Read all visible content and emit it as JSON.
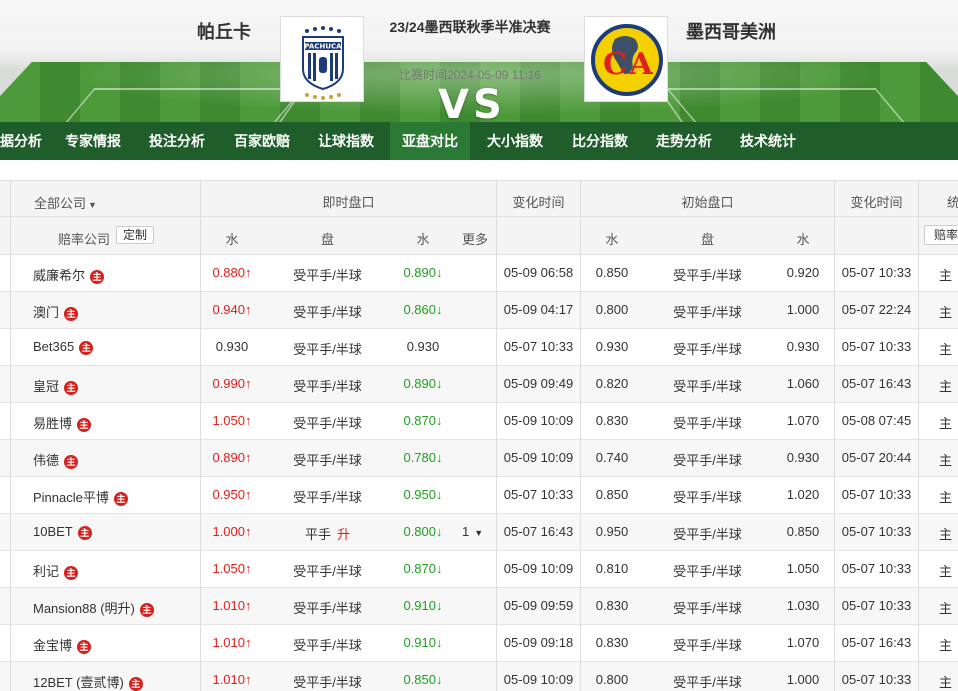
{
  "match": {
    "home_team": "帕丘卡",
    "away_team": "墨西哥美洲",
    "title": "23/24墨西联秋季半准决赛",
    "time": "比赛时间2024-05-09 11:16",
    "vs": "VS"
  },
  "nav": {
    "items": [
      "据分析",
      "专家情报",
      "投注分析",
      "百家欧赔",
      "让球指数",
      "亚盘对比",
      "大小指数",
      "比分指数",
      "走势分析",
      "技术统计"
    ],
    "active": "亚盘对比"
  },
  "table": {
    "header": {
      "all_companies": "全部公司",
      "live_group": "即时盘口",
      "change_time": "变化时间",
      "initial_group": "初始盘口",
      "change_time2": "变化时间",
      "stats_group": "统",
      "company_col": "赔率公司",
      "custom_btn": "定制",
      "water": "水",
      "handicap": "盘",
      "water2": "水",
      "more": "更多",
      "init_water": "水",
      "init_handicap": "盘",
      "init_water2": "水",
      "odds_btn": "赔率"
    },
    "badge": "主",
    "rows": [
      {
        "company": "威廉希尔",
        "live_home": "0.880",
        "live_home_dir": "up",
        "live_line": "受平手/半球",
        "live_line_change": "",
        "live_away": "0.890",
        "live_away_dir": "down",
        "more": "",
        "change_time": "05-09 06:58",
        "init_home": "0.850",
        "init_line": "受平手/半球",
        "init_away": "0.920",
        "init_time": "05-07 10:33",
        "tail": "主"
      },
      {
        "company": "澳门",
        "live_home": "0.940",
        "live_home_dir": "up",
        "live_line": "受平手/半球",
        "live_line_change": "",
        "live_away": "0.860",
        "live_away_dir": "down",
        "more": "",
        "change_time": "05-09 04:17",
        "init_home": "0.800",
        "init_line": "受平手/半球",
        "init_away": "1.000",
        "init_time": "05-07 22:24",
        "tail": "主"
      },
      {
        "company": "Bet365",
        "live_home": "0.930",
        "live_home_dir": "",
        "live_line": "受平手/半球",
        "live_line_change": "",
        "live_away": "0.930",
        "live_away_dir": "",
        "more": "",
        "change_time": "05-07 10:33",
        "init_home": "0.930",
        "init_line": "受平手/半球",
        "init_away": "0.930",
        "init_time": "05-07 10:33",
        "tail": "主"
      },
      {
        "company": "皇冠",
        "live_home": "0.990",
        "live_home_dir": "up",
        "live_line": "受平手/半球",
        "live_line_change": "",
        "live_away": "0.890",
        "live_away_dir": "down",
        "more": "",
        "change_time": "05-09 09:49",
        "init_home": "0.820",
        "init_line": "受平手/半球",
        "init_away": "1.060",
        "init_time": "05-07 16:43",
        "tail": "主"
      },
      {
        "company": "易胜博",
        "live_home": "1.050",
        "live_home_dir": "up",
        "live_line": "受平手/半球",
        "live_line_change": "",
        "live_away": "0.870",
        "live_away_dir": "down",
        "more": "",
        "change_time": "05-09 10:09",
        "init_home": "0.830",
        "init_line": "受平手/半球",
        "init_away": "1.070",
        "init_time": "05-08 07:45",
        "tail": "主"
      },
      {
        "company": "伟德",
        "live_home": "0.890",
        "live_home_dir": "up",
        "live_line": "受平手/半球",
        "live_line_change": "",
        "live_away": "0.780",
        "live_away_dir": "down",
        "more": "",
        "change_time": "05-09 10:09",
        "init_home": "0.740",
        "init_line": "受平手/半球",
        "init_away": "0.930",
        "init_time": "05-07 20:44",
        "tail": "主"
      },
      {
        "company": "Pinnacle平博",
        "live_home": "0.950",
        "live_home_dir": "up",
        "live_line": "受平手/半球",
        "live_line_change": "",
        "live_away": "0.950",
        "live_away_dir": "down",
        "more": "",
        "change_time": "05-07 10:33",
        "init_home": "0.850",
        "init_line": "受平手/半球",
        "init_away": "1.020",
        "init_time": "05-07 10:33",
        "tail": "主"
      },
      {
        "company": "10BET",
        "live_home": "1.000",
        "live_home_dir": "up",
        "live_line": "平手",
        "live_line_change": "升",
        "live_away": "0.800",
        "live_away_dir": "down",
        "more": "1",
        "change_time": "05-07 16:43",
        "init_home": "0.950",
        "init_line": "受平手/半球",
        "init_away": "0.850",
        "init_time": "05-07 10:33",
        "tail": "主"
      },
      {
        "company": "利记",
        "live_home": "1.050",
        "live_home_dir": "up",
        "live_line": "受平手/半球",
        "live_line_change": "",
        "live_away": "0.870",
        "live_away_dir": "down",
        "more": "",
        "change_time": "05-09 10:09",
        "init_home": "0.810",
        "init_line": "受平手/半球",
        "init_away": "1.050",
        "init_time": "05-07 10:33",
        "tail": "主"
      },
      {
        "company": "Mansion88 (明升)",
        "live_home": "1.010",
        "live_home_dir": "up",
        "live_line": "受平手/半球",
        "live_line_change": "",
        "live_away": "0.910",
        "live_away_dir": "down",
        "more": "",
        "change_time": "05-09 09:59",
        "init_home": "0.830",
        "init_line": "受平手/半球",
        "init_away": "1.030",
        "init_time": "05-07 10:33",
        "tail": "主"
      },
      {
        "company": "金宝博",
        "live_home": "1.010",
        "live_home_dir": "up",
        "live_line": "受平手/半球",
        "live_line_change": "",
        "live_away": "0.910",
        "live_away_dir": "down",
        "more": "",
        "change_time": "05-09 09:18",
        "init_home": "0.830",
        "init_line": "受平手/半球",
        "init_away": "1.070",
        "init_time": "05-07 16:43",
        "tail": "主"
      },
      {
        "company": "12BET (壹贰博)",
        "live_home": "1.010",
        "live_home_dir": "up",
        "live_line": "受平手/半球",
        "live_line_change": "",
        "live_away": "0.850",
        "live_away_dir": "down",
        "more": "",
        "change_time": "05-09 10:09",
        "init_home": "0.800",
        "init_line": "受平手/半球",
        "init_away": "1.000",
        "init_time": "05-07 10:33",
        "tail": "主"
      }
    ]
  },
  "colors": {
    "nav_bg": "#1f5e2a",
    "nav_active": "#2a7a36",
    "up": "#e0201e",
    "down": "#1ea11e",
    "badge": "#d6201c"
  },
  "icons": {
    "up": "arrow-up-icon",
    "down": "arrow-down-icon",
    "dropdown": "caret-down-icon",
    "home_logo": "pachuca-crest-icon",
    "away_logo": "club-america-crest-icon"
  }
}
